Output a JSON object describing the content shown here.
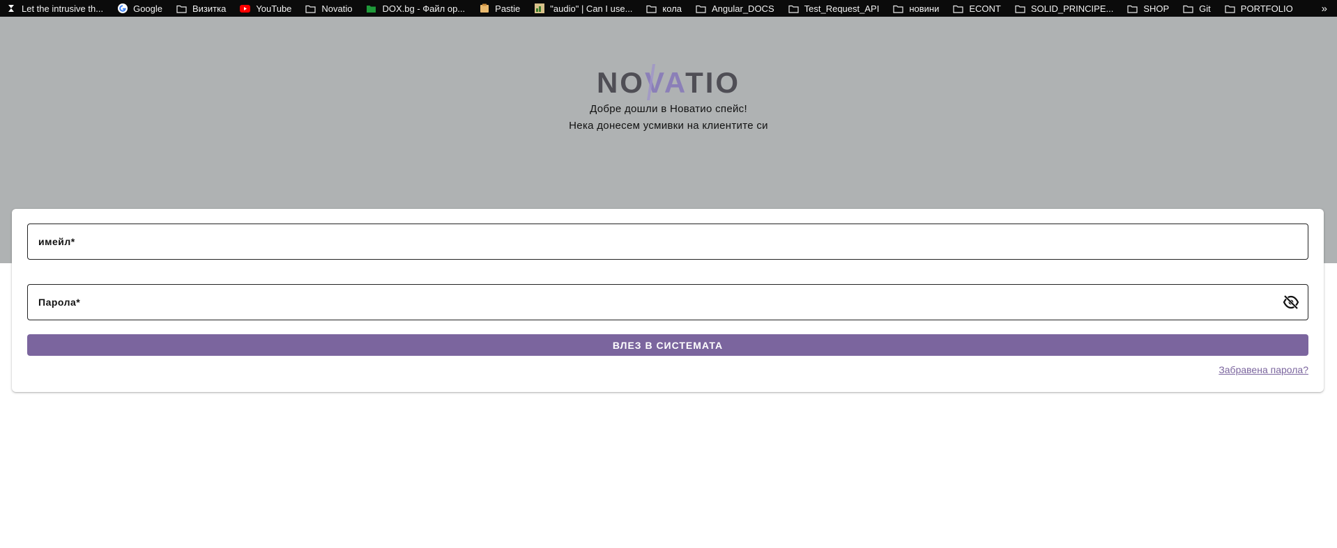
{
  "bookmarks": [
    {
      "label": "Let the intrusive th...",
      "icon": "site-icon"
    },
    {
      "label": "Google",
      "icon": "google-icon"
    },
    {
      "label": "Визитка",
      "icon": "folder-icon"
    },
    {
      "label": "YouTube",
      "icon": "youtube-icon"
    },
    {
      "label": "Novatio",
      "icon": "folder-icon"
    },
    {
      "label": "DOX.bg - Файл ор...",
      "icon": "folder-green-icon"
    },
    {
      "label": "Pastie",
      "icon": "pastie-icon"
    },
    {
      "label": "\"audio\" | Can I use...",
      "icon": "caniuse-icon"
    },
    {
      "label": "кола",
      "icon": "folder-icon"
    },
    {
      "label": "Angular_DOCS",
      "icon": "folder-icon"
    },
    {
      "label": "Test_Request_API",
      "icon": "folder-icon"
    },
    {
      "label": "новини",
      "icon": "folder-icon"
    },
    {
      "label": "ECONT",
      "icon": "folder-icon"
    },
    {
      "label": "SOLID_PRINCIPE...",
      "icon": "folder-icon"
    },
    {
      "label": "SHOP",
      "icon": "folder-icon"
    },
    {
      "label": "Git",
      "icon": "folder-icon"
    },
    {
      "label": "PORTFOLIO",
      "icon": "folder-icon"
    }
  ],
  "bookmarks_more": "»",
  "hero": {
    "logo_text_start": "NO",
    "logo_text_mid": "VA",
    "logo_text_end": "TIO",
    "welcome_line1": "Добре дошли в Новатио спейс!",
    "welcome_line2": "Нека донесем усмивки на клиентите си"
  },
  "form": {
    "email_label": "имейл*",
    "email_value": "",
    "password_label": "Парола*",
    "password_value": "",
    "password_toggle_icon": "eye-off-icon",
    "login_button": "ВЛЕЗ В СИСТЕМАТА",
    "forgot_link": "Забравена парола?"
  },
  "colors": {
    "hero_bg": "#afb2b3",
    "accent": "#7b659e",
    "bookmarks_bg": "#0b0b0b"
  }
}
